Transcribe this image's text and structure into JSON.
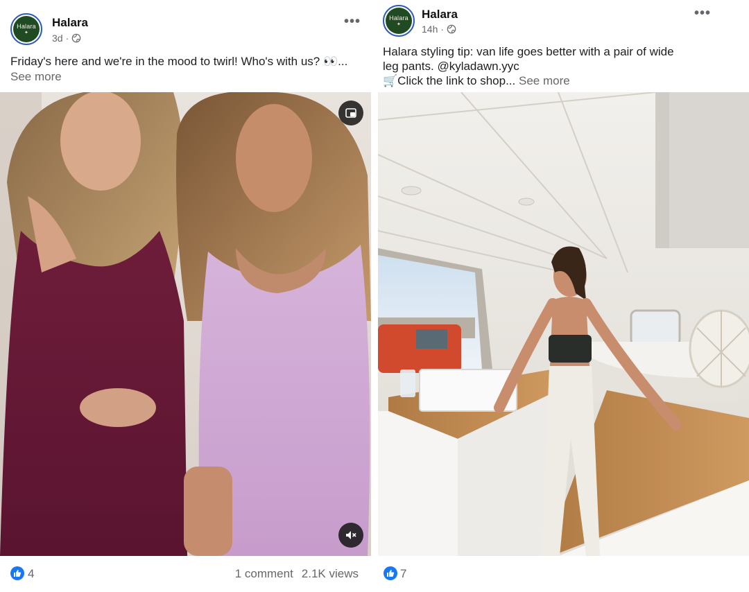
{
  "posts": [
    {
      "page_name": "Halara",
      "avatar_text": "Halara",
      "time": "3d",
      "dot": "·",
      "caption_text": "Friday's here and we're in the mood to twirl! Who's with us? 👀...",
      "see_more": "See more",
      "reactions": "4",
      "comments": "1 comment",
      "views": "2.1K views"
    },
    {
      "page_name": "Halara",
      "avatar_text": "Halara",
      "time": "14h",
      "dot": "·",
      "caption_line1": "Halara styling tip: van life goes better with a pair of wide",
      "caption_line2": "leg pants.  @kyladawn.yyc",
      "caption_line3": "🛒Click the link to shop...",
      "see_more": "See more",
      "reactions": "7"
    }
  ],
  "icons": {
    "more": "more-options-icon",
    "globe": "globe-icon",
    "pip": "picture-in-picture-icon",
    "mute": "muted-speaker-icon",
    "like": "thumbs-up-icon"
  },
  "colors": {
    "link_blue": "#1877f2",
    "meta_gray": "#65676b",
    "avatar_green": "#1f4a22"
  }
}
